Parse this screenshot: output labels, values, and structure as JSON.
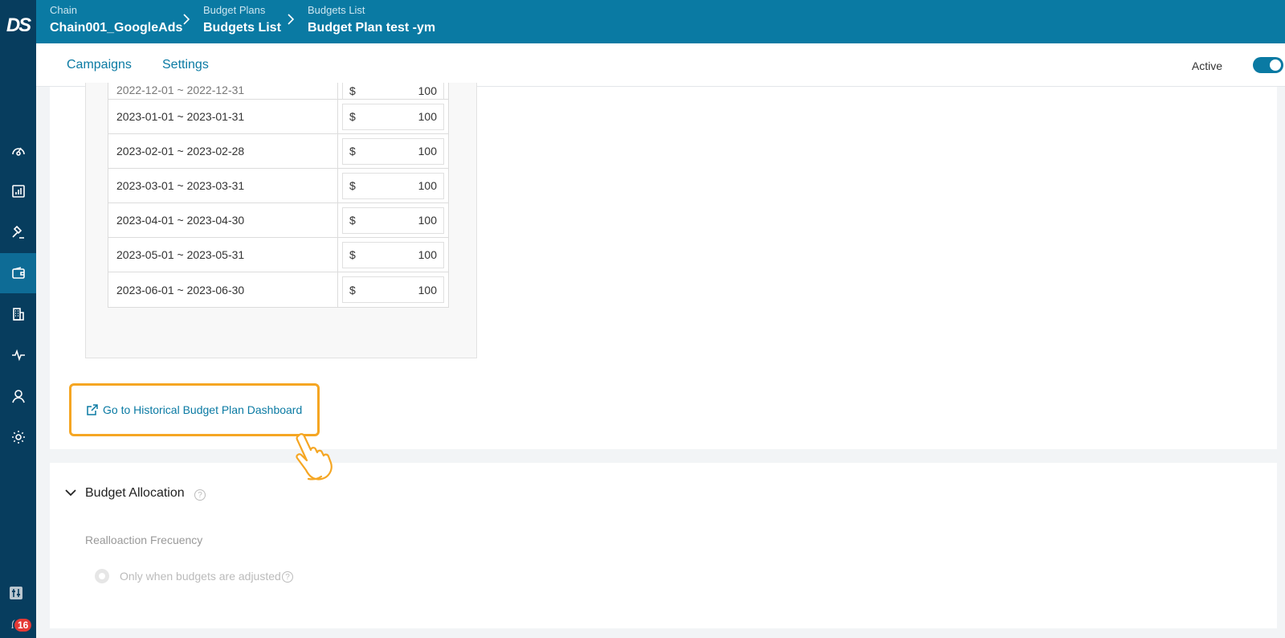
{
  "sidebar": {
    "logo": "DS",
    "items": [
      {
        "icon": "dashboard-gauge-icon"
      },
      {
        "icon": "analytics-chart-icon"
      },
      {
        "icon": "bidding-hammer-icon"
      },
      {
        "icon": "budget-wallet-icon",
        "active": true
      },
      {
        "icon": "building-icon"
      },
      {
        "icon": "activity-pulse-icon"
      },
      {
        "icon": "user-icon"
      },
      {
        "icon": "settings-gear-icon"
      }
    ],
    "notifications_count": "16"
  },
  "breadcrumb": [
    {
      "small": "Chain",
      "big": "Chain001_GoogleAds"
    },
    {
      "small": "Budget Plans",
      "big": "Budgets List"
    },
    {
      "small": "Budgets List",
      "big": "Budget Plan test -ym"
    }
  ],
  "tabs": [
    {
      "label": "Campaigns"
    },
    {
      "label": "Settings",
      "active": true
    }
  ],
  "status": {
    "label": "Active",
    "on": true
  },
  "budget_table": {
    "partial_row": {
      "date": "2022-12-01 ~ 2022-12-31",
      "currency": "$",
      "amount": "100"
    },
    "rows": [
      {
        "date": "2023-01-01 ~ 2023-01-31",
        "currency": "$",
        "amount": "100"
      },
      {
        "date": "2023-02-01 ~ 2023-02-28",
        "currency": "$",
        "amount": "100"
      },
      {
        "date": "2023-03-01 ~ 2023-03-31",
        "currency": "$",
        "amount": "100"
      },
      {
        "date": "2023-04-01 ~ 2023-04-30",
        "currency": "$",
        "amount": "100"
      },
      {
        "date": "2023-05-01 ~ 2023-05-31",
        "currency": "$",
        "amount": "100"
      },
      {
        "date": "2023-06-01 ~ 2023-06-30",
        "currency": "$",
        "amount": "100"
      }
    ]
  },
  "historical_link": {
    "label": "Go to Historical Budget Plan Dashboard",
    "icon": "external-link-icon"
  },
  "allocation": {
    "title": "Budget Allocation",
    "frequency_label": "Realloaction Frecuency",
    "option_label": "Only when budgets are adjusted"
  },
  "colors": {
    "header": "#0a7aa3",
    "sidebar": "#073d5e",
    "highlight": "#f5a623"
  }
}
